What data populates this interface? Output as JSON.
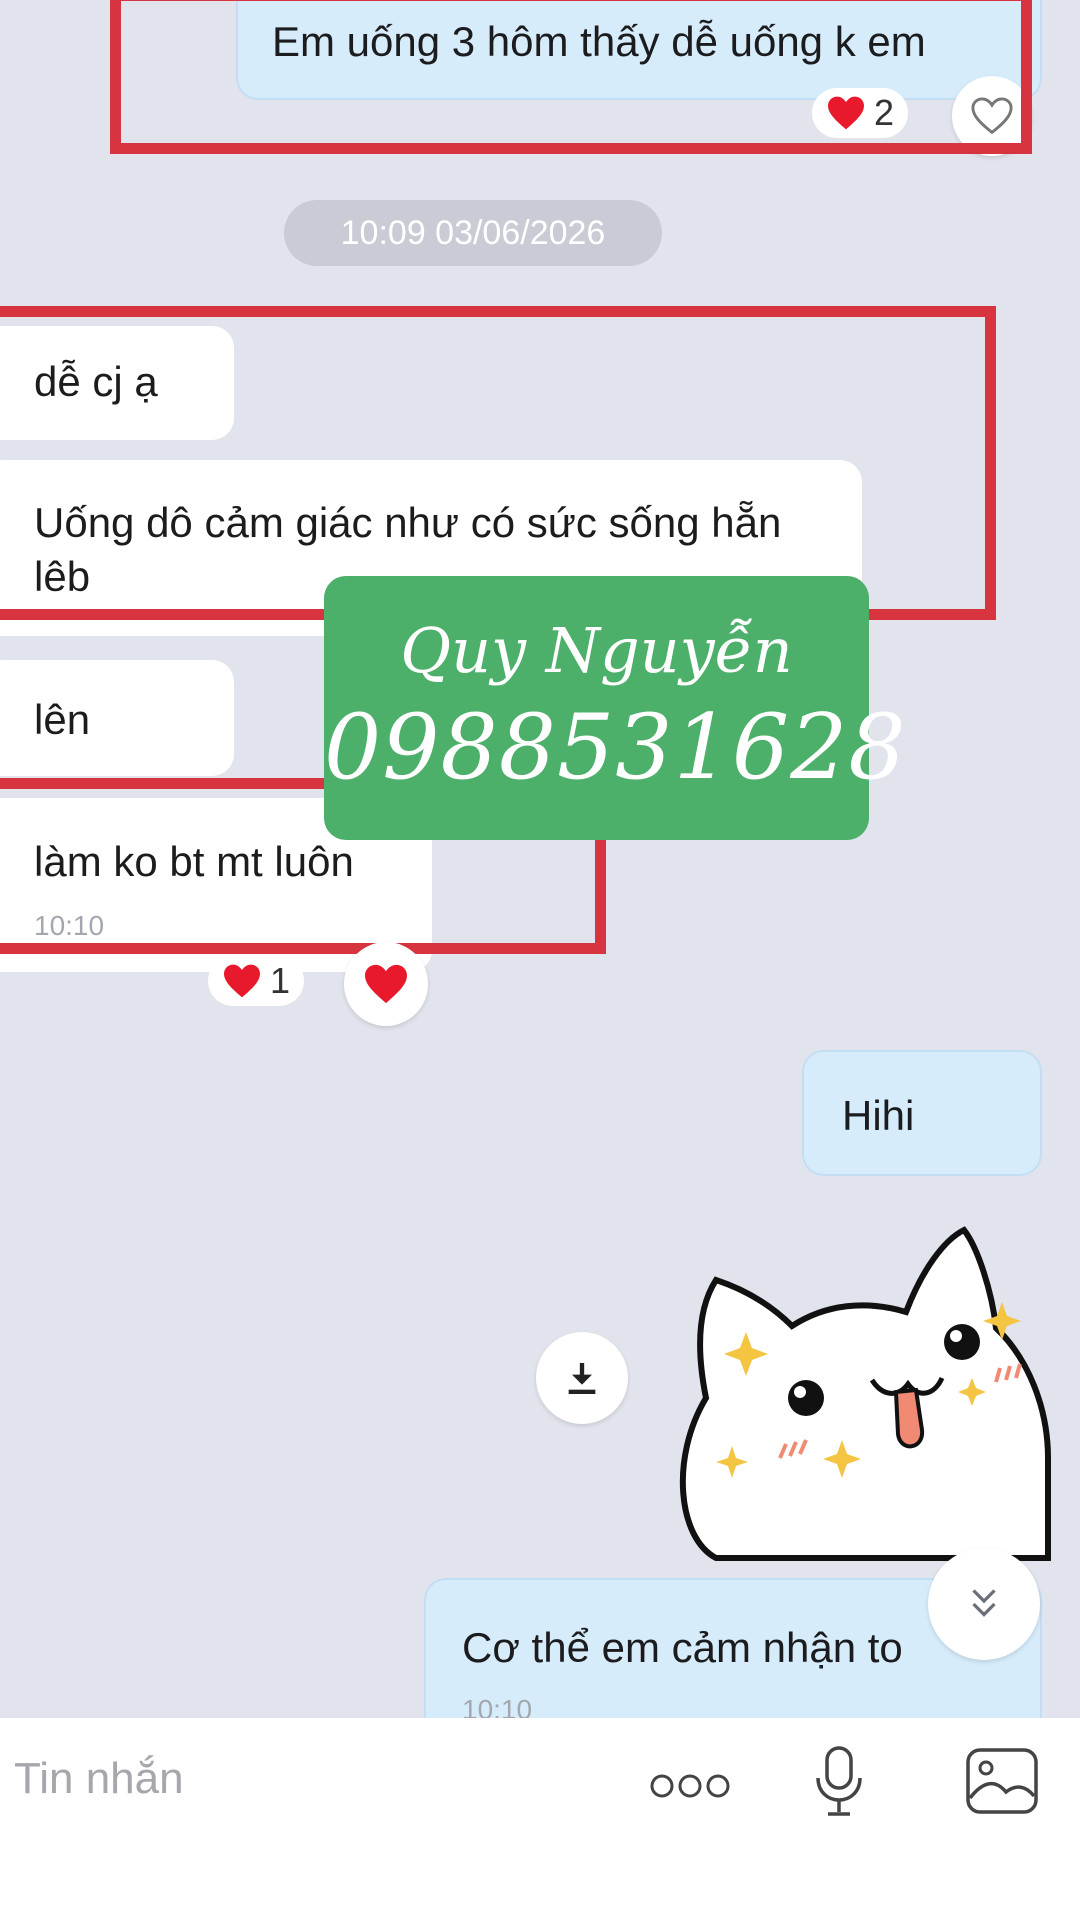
{
  "messages": {
    "m1_text": "Em uống 3 hôm thấy dễ uống k em",
    "m1_heart_count": "2",
    "date_separator": "10:09 03/06/2026",
    "m2_text": "dễ cj ạ",
    "m3_text": "Uống dô cảm giác như có sức sống hẵn lêb",
    "m4_text": "lên",
    "m5_text": "làm ko bt mt luôn",
    "m5_time": "10:10",
    "m5_heart_count": "1",
    "m6_text": "Hihi",
    "m7_text": "Cơ thể em cảm nhận to",
    "m7_time": "10:10"
  },
  "watermark": {
    "name": "Quy Nguyễn",
    "phone": "0988531628"
  },
  "composer": {
    "placeholder": "Tin nhắn"
  },
  "colors": {
    "background": "#e2e4ed",
    "outgoing_bubble": "#d6ecfb",
    "incoming_bubble": "#ffffff",
    "highlight_box": "#d8343f",
    "watermark_bg": "#4caf6a",
    "heart": "#e8192c"
  },
  "icons": {
    "reaction": "heart-icon",
    "like": "heart-outline-icon",
    "download": "download-icon",
    "scroll_down": "double-chevron-down-icon",
    "more": "more-dots-icon",
    "voice": "microphone-icon",
    "gallery": "image-icon"
  },
  "sticker": {
    "icon": "cat-sticker"
  }
}
